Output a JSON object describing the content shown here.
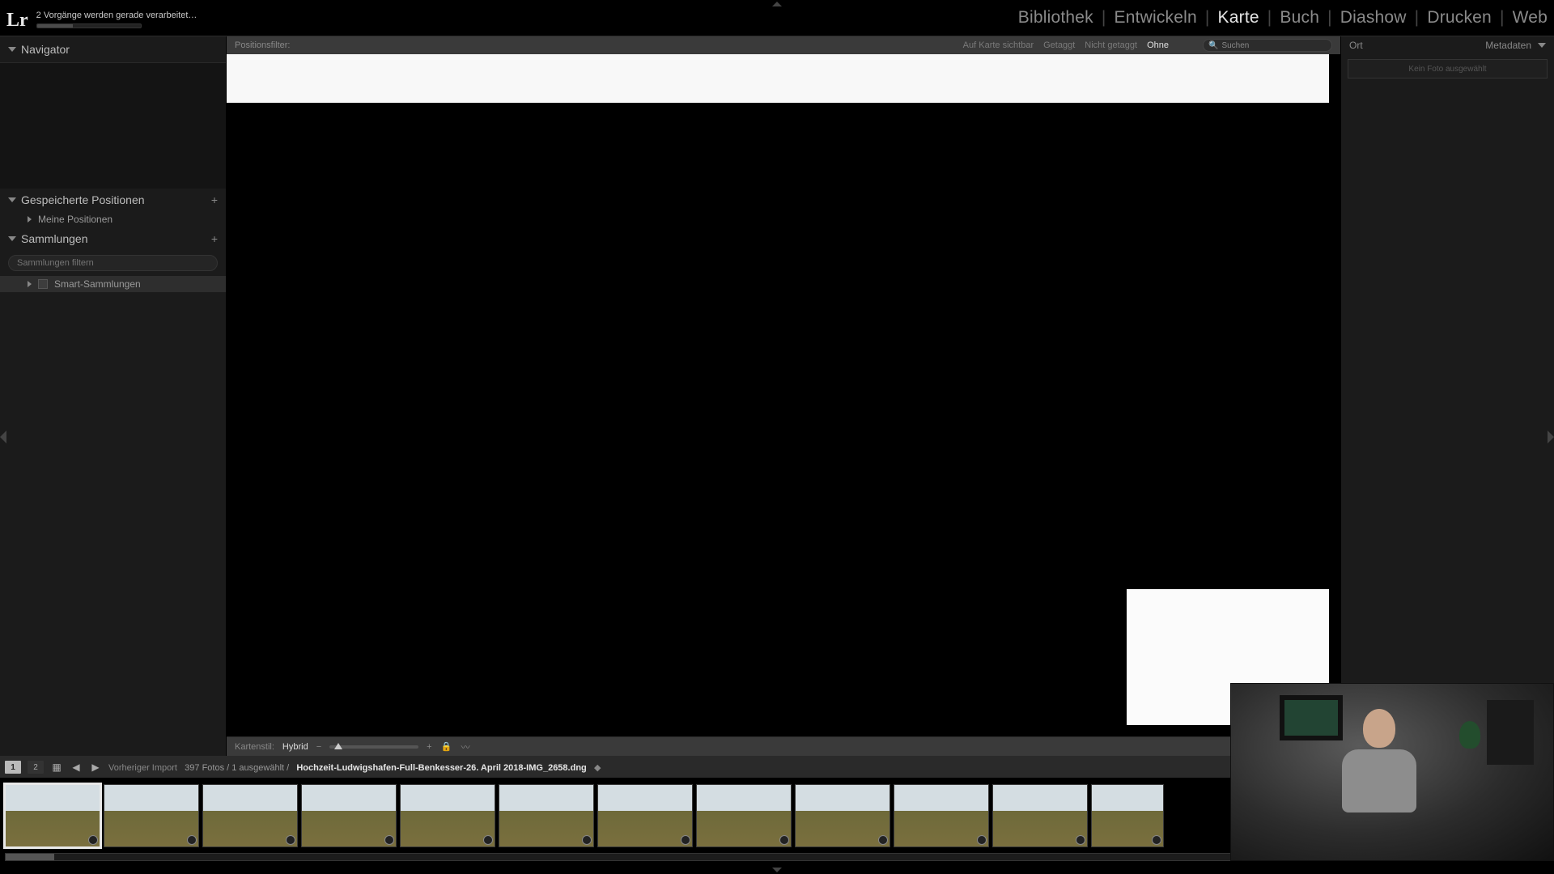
{
  "header": {
    "logo_text": "Lr",
    "status_text": "2 Vorgänge werden gerade verarbeitet…",
    "modules": [
      "Bibliothek",
      "Entwickeln",
      "Karte",
      "Buch",
      "Diashow",
      "Drucken",
      "Web"
    ],
    "active_module": "Karte"
  },
  "left": {
    "navigator_title": "Navigator",
    "saved_positions_title": "Gespeicherte Positionen",
    "saved_positions_item": "Meine Positionen",
    "collections_title": "Sammlungen",
    "smart_collections_label": "Smart-Sammlungen",
    "search_placeholder": "Sammlungen filtern"
  },
  "filterbar": {
    "label": "Positionsfilter:",
    "options": [
      "Auf Karte sichtbar",
      "Getaggt",
      "Nicht getaggt",
      "Ohne"
    ],
    "active_option": "Ohne",
    "search_placeholder": "Suchen"
  },
  "map_toolbar": {
    "style_label": "Kartenstil:",
    "style_value": "Hybrid"
  },
  "right": {
    "ort_label": "Ort",
    "metadata_label": "Metadaten",
    "empty_text": "Kein Foto ausgewählt"
  },
  "filmstrip": {
    "main_view": "1",
    "alt_view": "2",
    "source_label": "Vorheriger Import",
    "count_text": "397 Fotos / 1 ausgewählt /",
    "filename": "Hochzeit-Ludwigshafen-Full-Benkesser-26. April 2018-IMG_2658.dng",
    "dirty_marker": "◆",
    "thumb_count": 12
  }
}
